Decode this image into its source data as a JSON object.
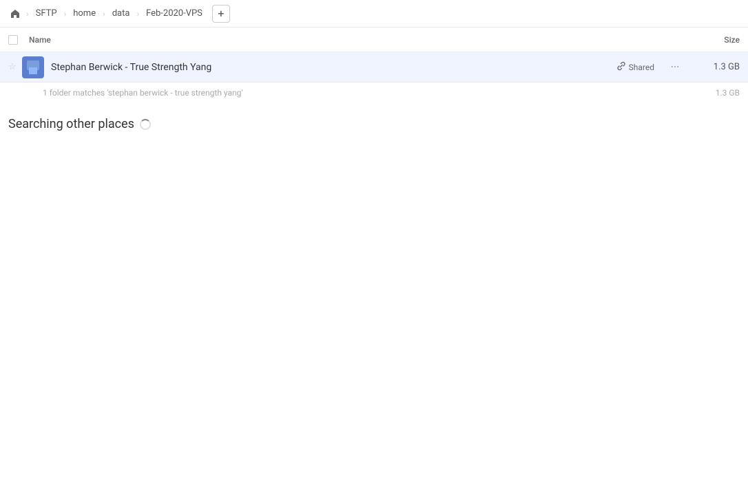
{
  "breadcrumb": {
    "home_label": "home",
    "items": [
      {
        "label": "SFTP"
      },
      {
        "label": "home"
      },
      {
        "label": "data"
      },
      {
        "label": "Feb-2020-VPS"
      }
    ],
    "add_button_label": "+"
  },
  "columns": {
    "name_label": "Name",
    "size_label": "Size"
  },
  "file_row": {
    "name": "Stephan Berwick - True Strength Yang",
    "shared_label": "Shared",
    "size": "1.3 GB"
  },
  "matches": {
    "text": "1 folder matches 'stephan berwick - true strength yang'",
    "size": "1.3 GB"
  },
  "searching": {
    "label": "Searching other places"
  }
}
